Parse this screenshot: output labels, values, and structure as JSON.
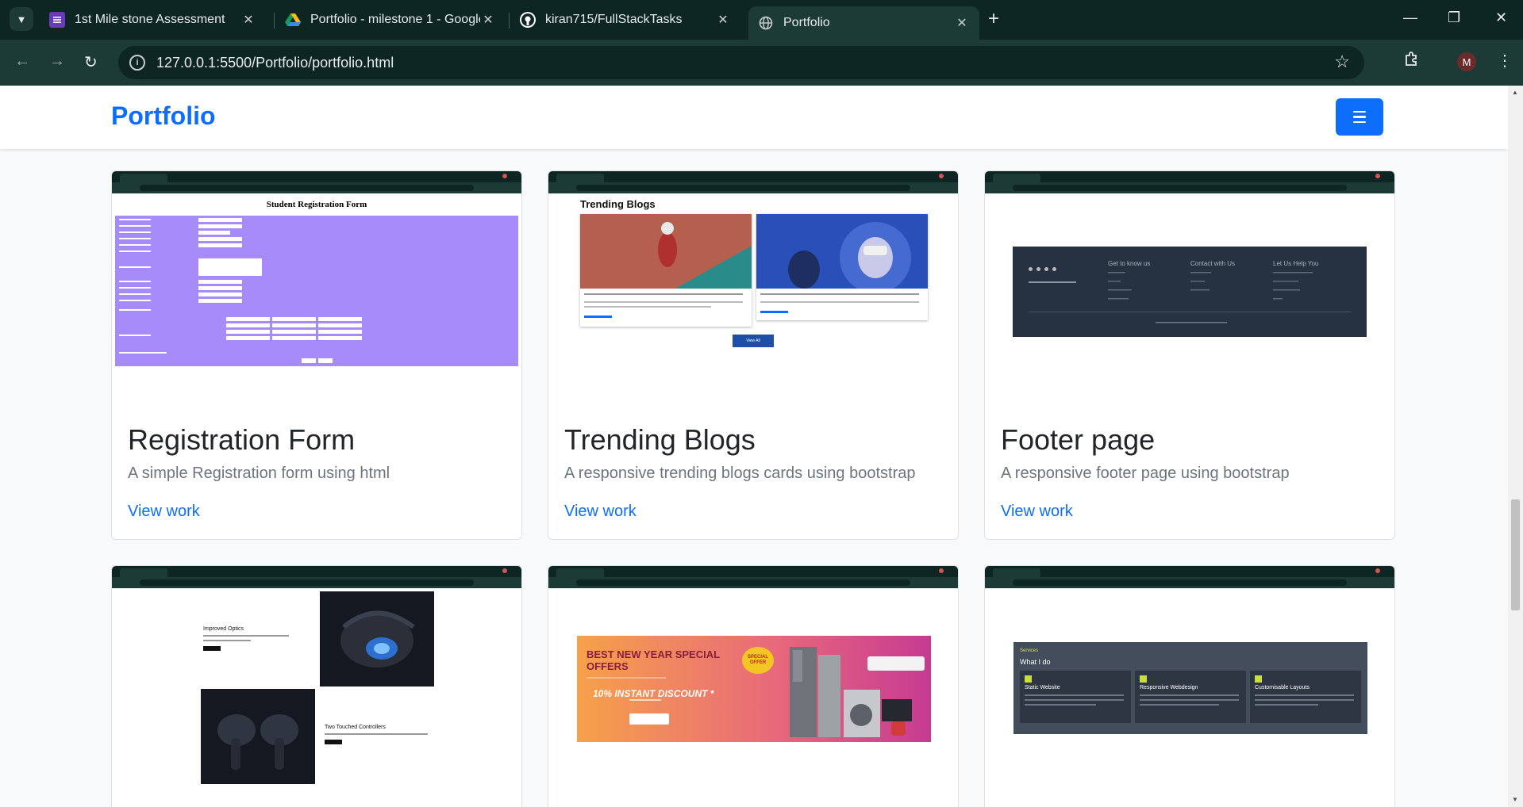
{
  "browser": {
    "tabs": [
      {
        "title": "1st Mile stone Assessment"
      },
      {
        "title": "Portfolio - milestone 1 - Google"
      },
      {
        "title": "kiran715/FullStackTasks"
      },
      {
        "title": "Portfolio"
      }
    ],
    "url": "127.0.0.1:5500/Portfolio/portfolio.html",
    "profile_initial": "M"
  },
  "site": {
    "brand": "Portfolio",
    "accent": "#0d6efd"
  },
  "projects": [
    {
      "title": "Registration Form",
      "description": "A simple Registration form using html",
      "link": "View work"
    },
    {
      "title": "Trending Blogs",
      "description": "A responsive trending blogs cards using bootstrap",
      "link": "View work"
    },
    {
      "title": "Footer page",
      "description": "A responsive footer page using bootstrap",
      "link": "View work"
    }
  ],
  "thumbnails": {
    "registration": {
      "heading": "Student Registration Form"
    },
    "blogs": {
      "heading": "Trending Blogs",
      "button": "View All"
    },
    "footer": {
      "col1": "Get to know us",
      "col2": "Contact with Us",
      "col3": "Let Us Help You"
    },
    "vr": {
      "text1": "Improved Optics",
      "text2": "Two Touched Controllers"
    },
    "offer": {
      "line1": "BEST NEW YEAR SPECIAL",
      "line2": "OFFERS",
      "discount": "10% INSTANT DISCOUNT *",
      "badge": "SPECIAL OFFER"
    },
    "services": {
      "kicker": "Services",
      "heading": "What I do",
      "c1": "Static Website",
      "c2": "Responsive Webdesign",
      "c3": "Customisable Layouts"
    }
  }
}
